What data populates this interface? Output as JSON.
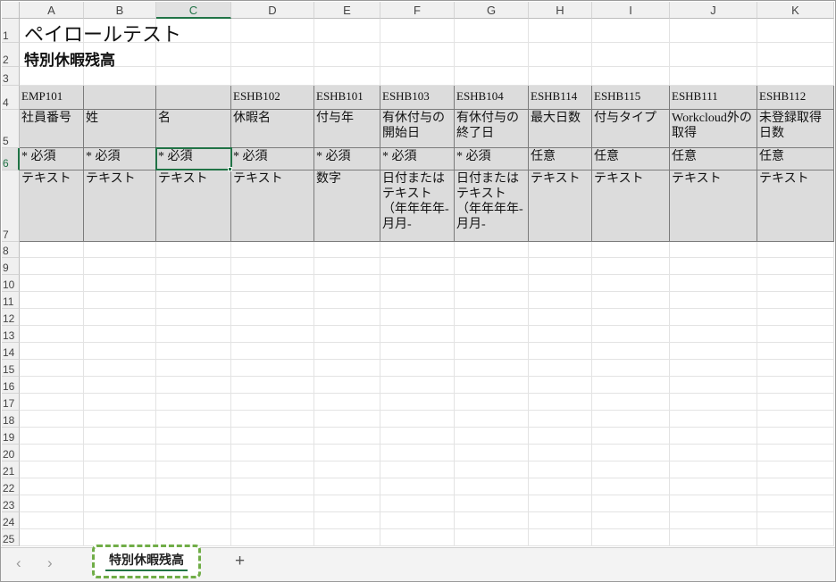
{
  "columns": [
    "A",
    "B",
    "C",
    "D",
    "E",
    "F",
    "G",
    "H",
    "I",
    "J",
    "K"
  ],
  "selected_column": "C",
  "rows": [
    "1",
    "2",
    "3",
    "4",
    "5",
    "6",
    "7",
    "8",
    "9",
    "10",
    "11",
    "12",
    "13",
    "14",
    "15",
    "16",
    "17",
    "18",
    "19",
    "20",
    "21",
    "22",
    "23",
    "24",
    "25"
  ],
  "selected_row": "6",
  "sheet_title": "ペイロールテスト",
  "sheet_subtitle": "特別休暇残高",
  "table": [
    [
      "EMP101",
      "",
      "",
      "ESHB102",
      "ESHB101",
      "ESHB103",
      "ESHB104",
      "ESHB114",
      "ESHB115",
      "ESHB111",
      "ESHB112"
    ],
    [
      "社員番号",
      "姓",
      "名",
      "休暇名",
      "付与年",
      "有休付与の開始日",
      "有休付与の終了日",
      "最大日数",
      "付与タイプ",
      "Workcloud外の取得",
      "未登録取得日数"
    ],
    [
      "* 必須",
      "* 必須",
      "* 必須",
      "* 必須",
      "* 必須",
      "* 必須",
      "* 必須",
      "任意",
      "任意",
      "任意",
      "任意"
    ],
    [
      "テキスト",
      "テキスト",
      "テキスト",
      "テキスト",
      "数字",
      "日付またはテキスト（年年年年-月月-",
      "日付またはテキスト（年年年年-月月-",
      "テキスト",
      "テキスト",
      "テキスト",
      "テキスト"
    ]
  ],
  "active_cell": "C6",
  "tabs": {
    "sheet_tab_label": "特別休暇残高",
    "prev_icon": "chevron-left-icon",
    "next_icon": "chevron-right-icon",
    "add_icon": "plus-icon"
  },
  "colors": {
    "accent": "#217346",
    "highlight_border": "#70ad47",
    "cell_fill": "#dcdcdc"
  }
}
